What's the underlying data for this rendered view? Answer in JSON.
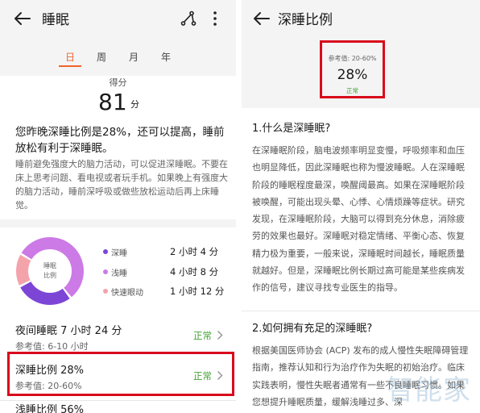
{
  "left": {
    "title": "睡眠",
    "tabs": [
      "日",
      "周",
      "月",
      "年"
    ],
    "active_tab": "日",
    "score_label": "得分",
    "score_value": "81",
    "score_unit": "分",
    "summary_title": "您昨晚深睡比例是28%，还可以提高，睡前放松有利于深睡眠。",
    "summary_desc": "睡前避免强度大的脑力活动，可以促进深睡眠。不要在床上思考问题、看电视或者玩手机。如果晚上有强度大的脑力活动，睡前深呼吸或做些放松运动后再上床睡觉。",
    "donut_label_line1": "睡眠",
    "donut_label_line2": "比例",
    "stages": [
      {
        "name": "深睡",
        "value": "2 小时 4 分",
        "color": "#7d45d6",
        "fraction": 0.28
      },
      {
        "name": "浅睡",
        "value": "4 小时 8 分",
        "color": "#cc7ae6",
        "fraction": 0.56
      },
      {
        "name": "快速眼动",
        "value": "1 小时 12 分",
        "color": "#f4a3ab",
        "fraction": 0.16
      }
    ],
    "metrics": [
      {
        "title": "夜间睡眠  7 小时 24 分",
        "ref": "参考值: 6-10 小时",
        "status": "正常"
      },
      {
        "title": "深睡比例  28%",
        "ref": "参考值: 20-60%",
        "status": "正常"
      }
    ],
    "partial_item": "浅睡比例  56%"
  },
  "right": {
    "title": "深睡比例",
    "ref_text": "参考值: 20-60%",
    "ratio_value": "28%",
    "status": "正常",
    "sections": [
      {
        "heading": "1.什么是深睡眠?",
        "body": "在深睡眠阶段，脑电波频率明显变慢，呼吸频率和血压也明显降低，因此深睡眠也称为慢波睡眠。人在深睡眠阶段的睡眠程度最深，唤醒阈最高。如果在深睡眠阶段被唤醒，可能出现头晕、心悸、心情烦躁等症状。研究发现，在深睡眠阶段，大脑可以得到充分休息，消除疲劳的效果也最好。深睡眠对稳定情绪、平衡心态、恢复精力极为重要，一般来说，深睡眠时间越长，睡眠质量就越好。但是，深睡眠比例长期过高可能是某些疾病发作的信号，建议寻找专业医生的指导。"
      },
      {
        "heading": "2.如何拥有充足的深睡眠?",
        "body": "根据美国医师协会 (ACP) 发布的成人慢性失眠障碍管理指南，推荐认知和行为治疗作为失眠的初始治疗。临床实践表明，慢性失眠者通常有一些不良睡眠习惯。如果您想提升睡眠质量，缓解浅睡过多、深"
      }
    ],
    "watermark": "智能家"
  }
}
